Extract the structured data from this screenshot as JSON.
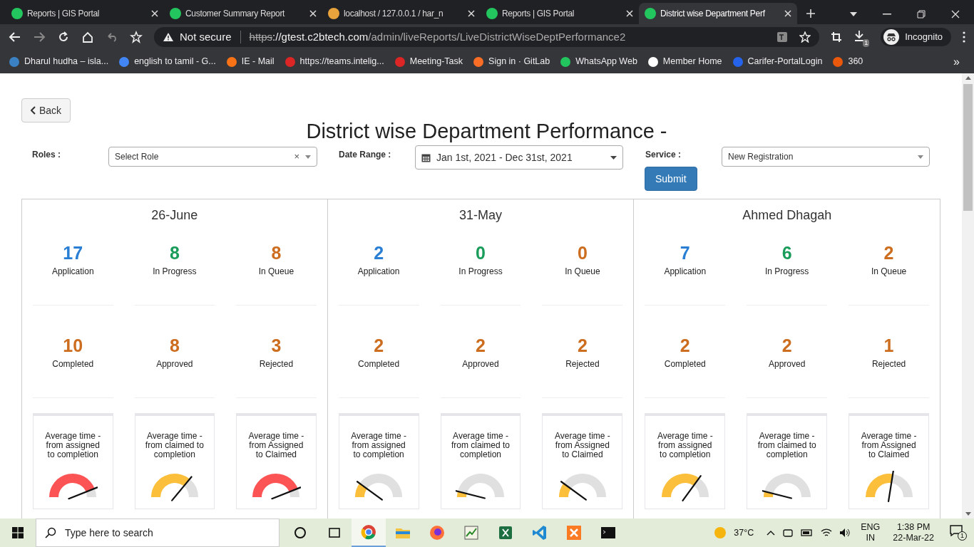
{
  "browser": {
    "tabs": [
      {
        "title": "Reports | GIS Portal",
        "selected": false,
        "color": "#22c55e"
      },
      {
        "title": "Customer Summary Report",
        "selected": false,
        "color": "#22c55e"
      },
      {
        "title": "localhost / 127.0.0.1 / har_n",
        "selected": false,
        "color": "#e8a33d"
      },
      {
        "title": "Reports | GIS Portal",
        "selected": false,
        "color": "#22c55e"
      },
      {
        "title": "District wise Department Perf",
        "selected": true,
        "color": "#22c55e"
      }
    ],
    "security": "Not secure",
    "scheme": "https",
    "host": "://gtest.c2btech.com",
    "path": "/admin/liveReports/LiveDistrictWiseDeptPerformance2",
    "download_count": "1",
    "profile": "Incognito",
    "bookmarks": [
      {
        "label": "Dharul hudha – isla...",
        "color": "#3b82c4"
      },
      {
        "label": "english to tamil - G...",
        "color": "#4285f4"
      },
      {
        "label": "IE - Mail",
        "color": "#f97316"
      },
      {
        "label": "https://teams.intelig...",
        "color": "#dc2626"
      },
      {
        "label": "Meeting-Task",
        "color": "#dc2626"
      },
      {
        "label": "Sign in · GitLab",
        "color": "#fc6d26"
      },
      {
        "label": "WhatsApp Web",
        "color": "#22c55e"
      },
      {
        "label": "Member Home",
        "color": "#ffffff"
      },
      {
        "label": "Carifer-PortalLogin",
        "color": "#2563eb"
      },
      {
        "label": "360",
        "color": "#ea580c"
      }
    ],
    "bookmarks_more": "»"
  },
  "page": {
    "back": "Back",
    "title": "District wise Department Performance -",
    "filters": {
      "roles_label": "Roles :",
      "roles_value": "Select Role",
      "roles_clear": "×",
      "date_label": "Date Range :",
      "date_value": "Jan 1st, 2021 - Dec 31st, 2021",
      "service_label": "Service :",
      "service_value": "New Registration",
      "submit": "Submit"
    },
    "panels": [
      {
        "name": "26-June",
        "stats": [
          {
            "value": "17",
            "label": "Application",
            "color": "#2a7fd4"
          },
          {
            "value": "8",
            "label": "In Progress",
            "color": "#1a9c5a"
          },
          {
            "value": "8",
            "label": "In Queue",
            "color": "#cc6d1f"
          },
          {
            "value": "10",
            "label": "Completed",
            "color": "#cc6d1f"
          },
          {
            "value": "8",
            "label": "Approved",
            "color": "#cc6d1f"
          },
          {
            "value": "3",
            "label": "Rejected",
            "color": "#cc6d1f"
          }
        ],
        "gauges": [
          {
            "title": "Average time - from assigned to completion",
            "level": 0.88,
            "color": "#fc5454"
          },
          {
            "title": "Average time - from claimed to completion",
            "level": 0.72,
            "color": "#fbbf3c"
          },
          {
            "title": "Average time - from Assigned to Claimed",
            "level": 0.88,
            "color": "#fc5454"
          }
        ]
      },
      {
        "name": "31-May",
        "stats": [
          {
            "value": "2",
            "label": "Application",
            "color": "#2a7fd4"
          },
          {
            "value": "0",
            "label": "In Progress",
            "color": "#1a9c5a"
          },
          {
            "value": "0",
            "label": "In Queue",
            "color": "#cc6d1f"
          },
          {
            "value": "2",
            "label": "Completed",
            "color": "#cc6d1f"
          },
          {
            "value": "2",
            "label": "Approved",
            "color": "#cc6d1f"
          },
          {
            "value": "2",
            "label": "Rejected",
            "color": "#cc6d1f"
          }
        ],
        "gauges": [
          {
            "title": "Average time - from assigned to completion",
            "level": 0.2,
            "color": "#fbbf3c"
          },
          {
            "title": "Average time - from claimed to completion",
            "level": 0.08,
            "color": "#fbbf3c"
          },
          {
            "title": "Average time - from Assigned to Claimed",
            "level": 0.2,
            "color": "#fbbf3c"
          }
        ]
      },
      {
        "name": "Ahmed Dhagah",
        "stats": [
          {
            "value": "7",
            "label": "Application",
            "color": "#2a7fd4"
          },
          {
            "value": "6",
            "label": "In Progress",
            "color": "#1a9c5a"
          },
          {
            "value": "2",
            "label": "In Queue",
            "color": "#cc6d1f"
          },
          {
            "value": "2",
            "label": "Completed",
            "color": "#cc6d1f"
          },
          {
            "value": "2",
            "label": "Approved",
            "color": "#cc6d1f"
          },
          {
            "value": "1",
            "label": "Rejected",
            "color": "#cc6d1f"
          }
        ],
        "gauges": [
          {
            "title": "Average time - from assigned to completion",
            "level": 0.7,
            "color": "#fbbf3c"
          },
          {
            "title": "Average time - from claimed to completion",
            "level": 0.08,
            "color": "#fbbf3c"
          },
          {
            "title": "Average time - from Assigned to Claimed",
            "level": 0.55,
            "color": "#fbbf3c"
          }
        ]
      }
    ]
  },
  "taskbar": {
    "search_placeholder": "Type here to search",
    "temperature": "37°C",
    "language": "ENG",
    "region": "IN",
    "time": "1:38 PM",
    "date": "22-Mar-22",
    "notifications": "1"
  }
}
